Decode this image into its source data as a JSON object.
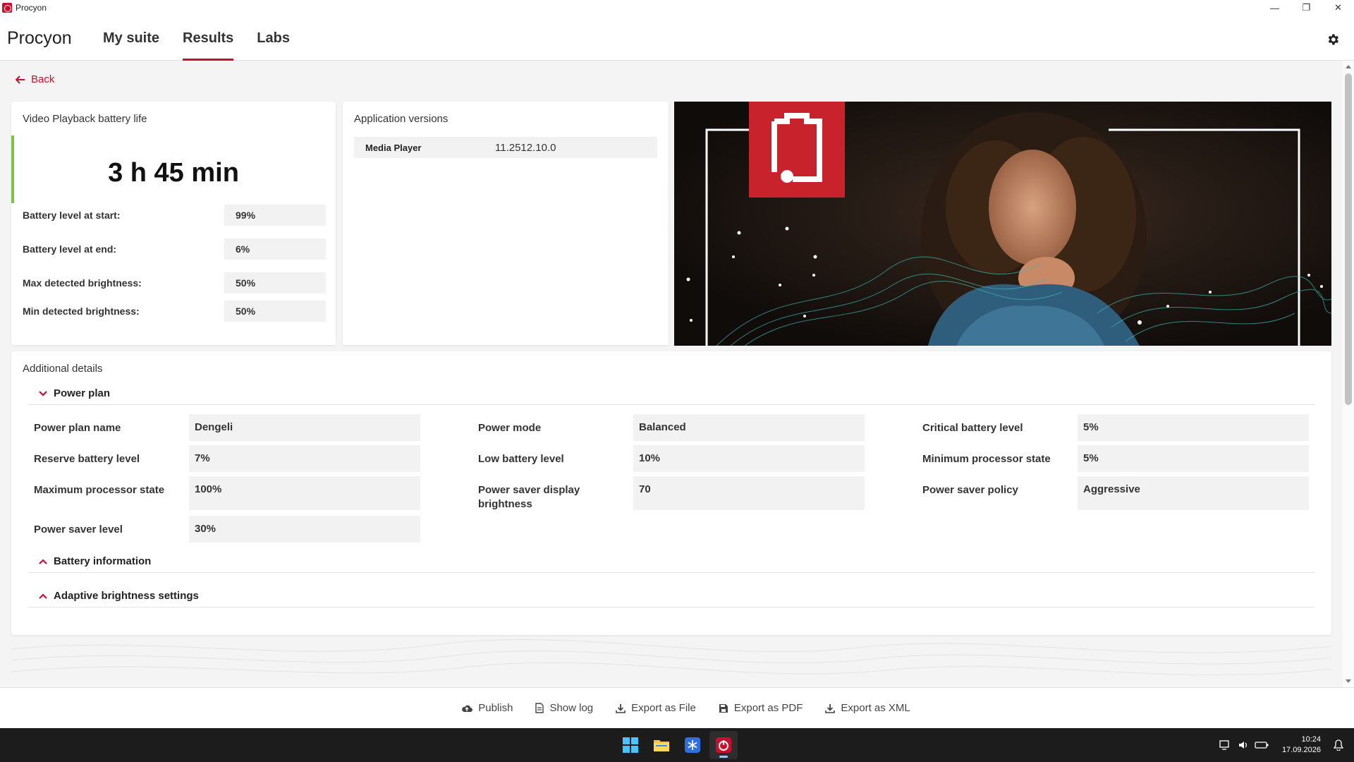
{
  "window": {
    "title": "Procyon"
  },
  "header": {
    "brand": "Procyon",
    "tabs": [
      {
        "label": "My suite"
      },
      {
        "label": "Results"
      },
      {
        "label": "Labs"
      }
    ],
    "active_tab": "Results"
  },
  "back_label": "Back",
  "result": {
    "title": "Video Playback battery life",
    "score": "3 h 45 min",
    "rows": [
      {
        "label": "Battery level at start:",
        "value": "99%"
      },
      {
        "label": "Battery level at end:",
        "value": "6%"
      },
      {
        "label": "Max detected brightness:",
        "value": "50%"
      },
      {
        "label": "Min detected brightness:",
        "value": "50%"
      }
    ]
  },
  "app_versions": {
    "title": "Application versions",
    "rows": [
      {
        "label": "Media Player",
        "value": "11.2512.10.0"
      }
    ]
  },
  "details": {
    "title": "Additional details",
    "sections": [
      {
        "label": "Power plan",
        "expanded": true
      },
      {
        "label": "Battery information",
        "expanded": false
      },
      {
        "label": "Adaptive brightness settings",
        "expanded": false
      }
    ],
    "power_plan": [
      {
        "label": "Power plan name",
        "value": "Dengeli"
      },
      {
        "label": "Power mode",
        "value": "Balanced"
      },
      {
        "label": "Critical battery level",
        "value": "5%"
      },
      {
        "label": "Reserve battery level",
        "value": "7%"
      },
      {
        "label": "Low battery level",
        "value": "10%"
      },
      {
        "label": "Minimum processor state",
        "value": "5%"
      },
      {
        "label": "Maximum processor state",
        "value": "100%"
      },
      {
        "label": "Power saver display brightness",
        "value": "70"
      },
      {
        "label": "Power saver policy",
        "value": "Aggressive"
      },
      {
        "label": "Power saver level",
        "value": "30%"
      }
    ]
  },
  "actions": [
    {
      "label": "Publish",
      "icon": "cloud-upload-icon"
    },
    {
      "label": "Show log",
      "icon": "document-icon"
    },
    {
      "label": "Export as File",
      "icon": "download-icon"
    },
    {
      "label": "Export as PDF",
      "icon": "save-icon"
    },
    {
      "label": "Export as XML",
      "icon": "download-icon"
    }
  ],
  "taskbar": {
    "apps": [
      "windows-start-icon",
      "file-explorer-icon",
      "snowflake-app-icon",
      "procyon-app-icon"
    ],
    "time": "10:24",
    "date": "17.09.2026"
  },
  "colors": {
    "accent": "#c8102e",
    "score_bar": "#7cc242"
  }
}
